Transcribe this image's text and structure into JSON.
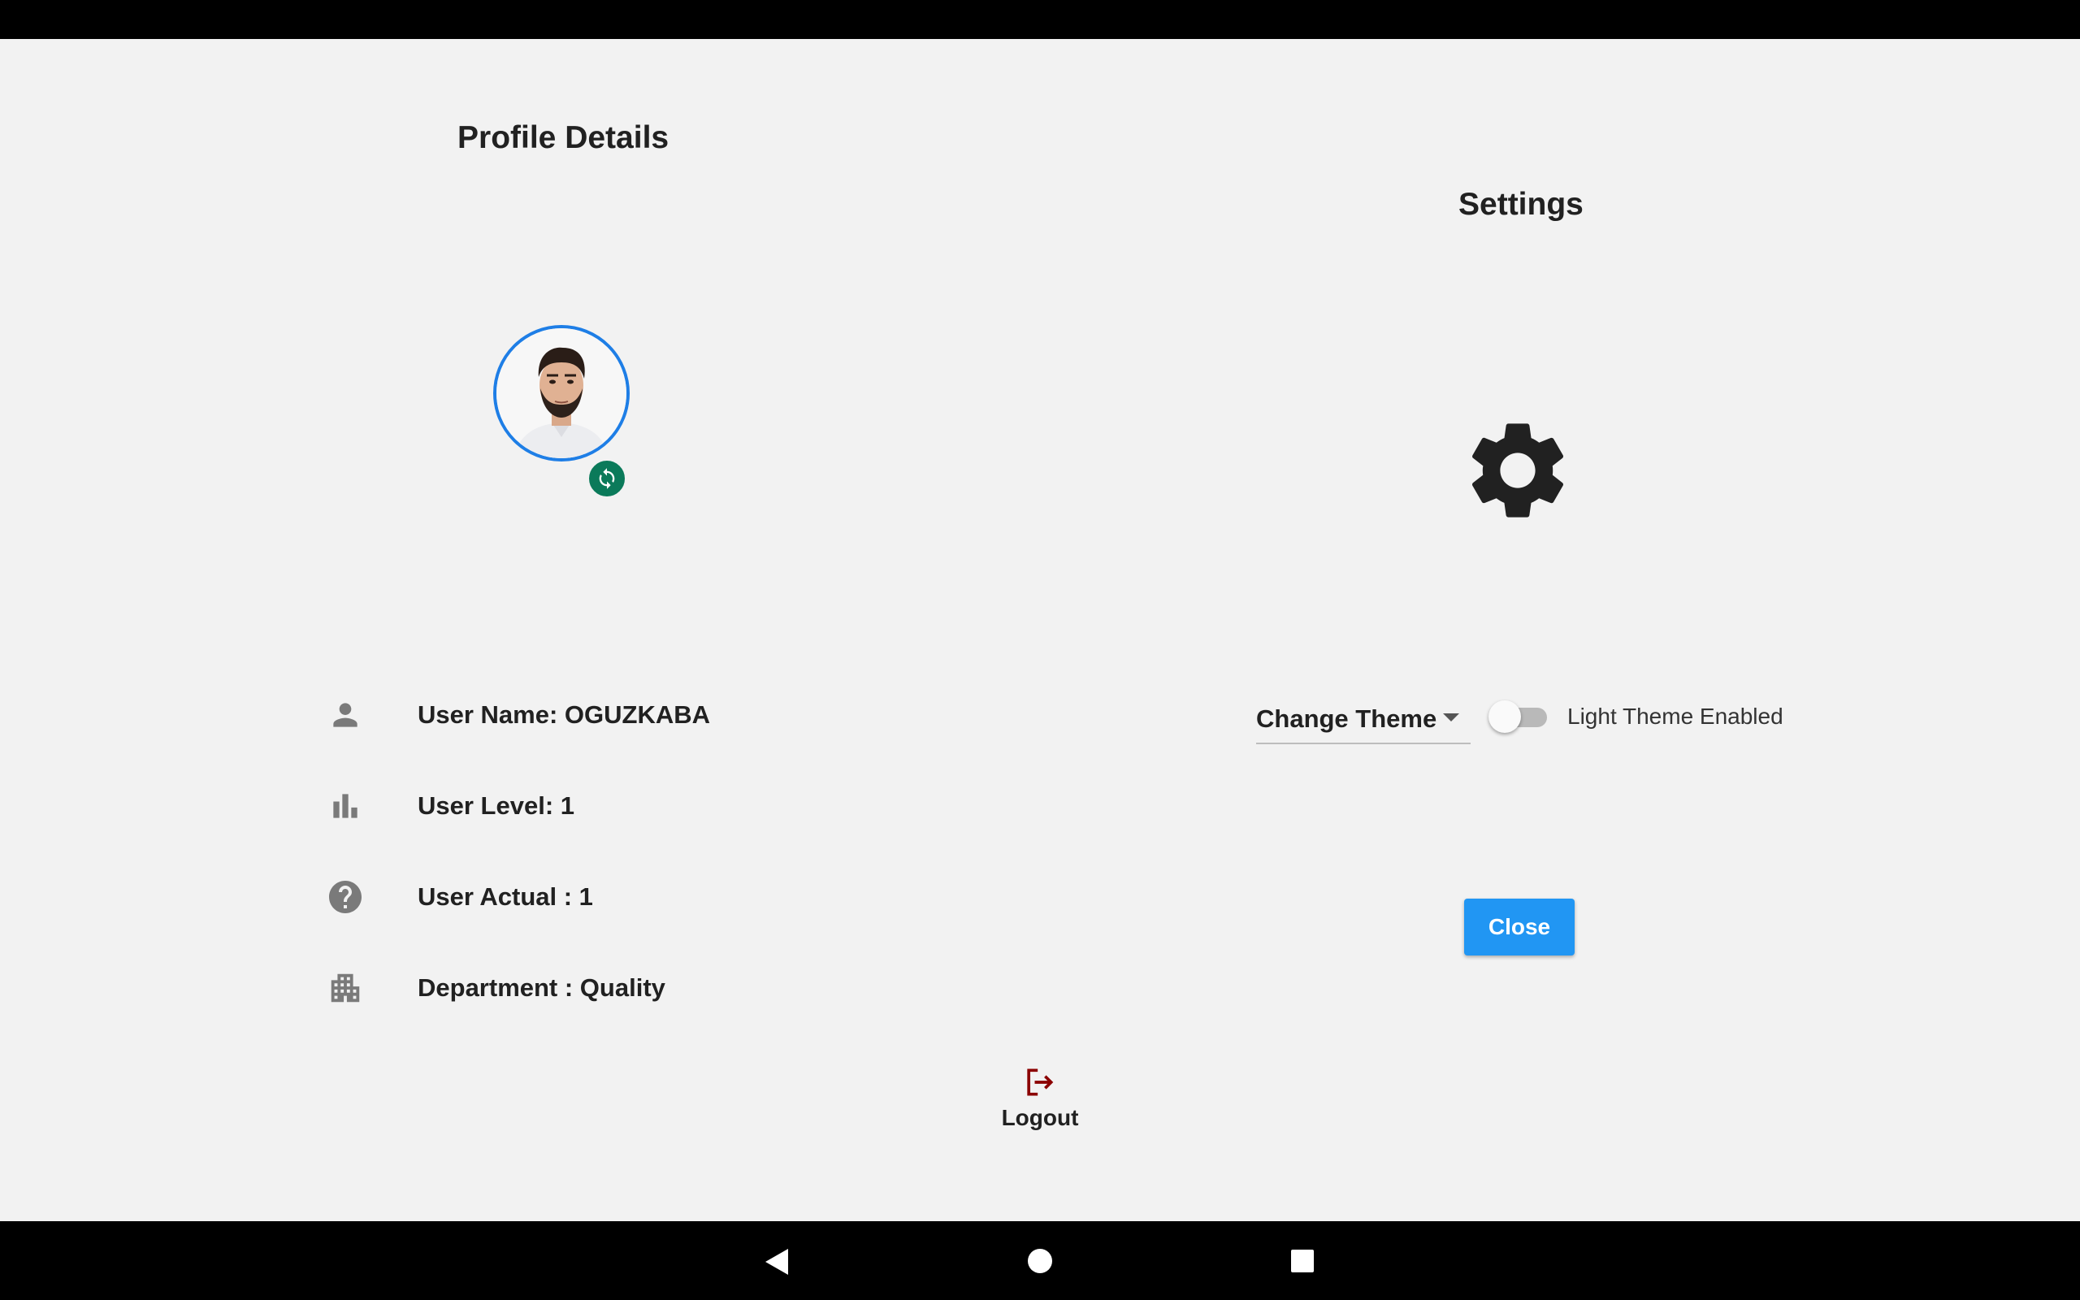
{
  "profile": {
    "title": "Profile Details",
    "avatar_icon": "user-photo",
    "sync_icon": "sync-icon",
    "fields": [
      {
        "icon": "person-icon",
        "label": "User Name:  OGUZKABA"
      },
      {
        "icon": "bar-chart-icon",
        "label": "User Level:  1"
      },
      {
        "icon": "help-icon",
        "label": "User Actual : 1"
      },
      {
        "icon": "building-icon",
        "label": "Department : Quality"
      }
    ]
  },
  "settings": {
    "title": "Settings",
    "gear_icon": "gear-icon",
    "theme_dropdown": {
      "selected": "Change Theme"
    },
    "theme_toggle": {
      "enabled": false,
      "label": "Light Theme Enabled"
    },
    "close_label": "Close"
  },
  "logout": {
    "label": "Logout",
    "icon": "logout-icon"
  },
  "colors": {
    "background": "#f2f2f2",
    "primary_button": "#2196f3",
    "avatar_ring": "#1e7ee6",
    "sync_badge": "#0b7a5a",
    "logout_icon": "#8b0000",
    "icon_grey": "#7a7a7a"
  },
  "navigation": {
    "back_icon": "back-icon",
    "home_icon": "home-icon",
    "recents_icon": "recents-icon"
  }
}
